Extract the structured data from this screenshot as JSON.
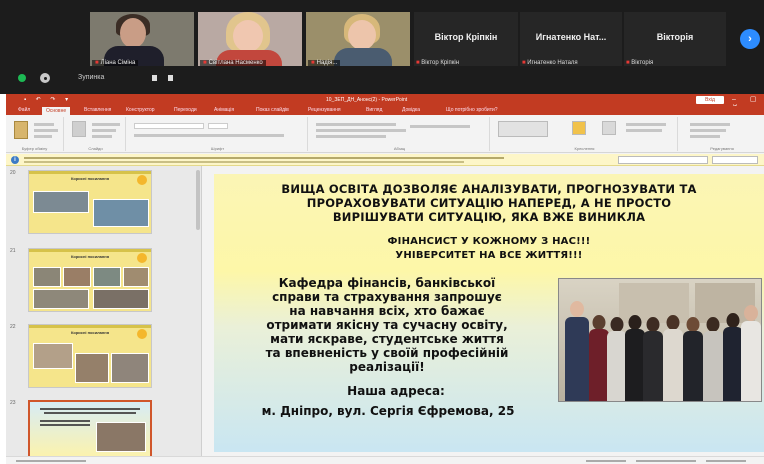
{
  "conference": {
    "participants": [
      {
        "name": "Ліана Сіміна",
        "kind": "video"
      },
      {
        "name": "Світлана Насменко",
        "kind": "video"
      },
      {
        "name": "Надія...",
        "kind": "video"
      },
      {
        "name": "Віктор Кріпкін",
        "kind": "name",
        "subname": "Віктор Кріпкін"
      },
      {
        "name": "Игнатенко Нат...",
        "kind": "name",
        "subname": "Игнатенко Наталя"
      },
      {
        "name": "Вікторія",
        "kind": "name",
        "subname": "Вікторія"
      }
    ],
    "next_icon": "chevron-right-icon",
    "control_label": "Зупинка"
  },
  "powerpoint": {
    "accent": "#c23b22",
    "window_title": "10_ЗЕП_ДН_Анонс(2) - PowerPoint",
    "signin": "Вхід",
    "tabs": [
      "Файл",
      "Основне",
      "Вставлення",
      "Конструктор",
      "Переходи",
      "Анімація",
      "Показ слайдів",
      "Рецензування",
      "Вигляд",
      "Довідка",
      "Що потрібно зробити?"
    ],
    "ribbon_groups": [
      "Буфер обміну",
      "Слайди",
      "Шрифт",
      "Абзац",
      "Креслення",
      "Редагування"
    ],
    "thumbnails": [
      {
        "number": "20",
        "title": "Корисні посилання"
      },
      {
        "number": "21",
        "title": "Корисні посилання"
      },
      {
        "number": "22",
        "title": "Корисні посилання"
      },
      {
        "number": "23",
        "title": ""
      }
    ]
  },
  "slide": {
    "heading_lines": [
      "ВИЩА ОСВІТА ДОЗВОЛЯЄ АНАЛІЗУВАТИ, ПРОГНОЗУВАТИ ТА",
      "ПРОРАХОВУВАТИ СИТУАЦІЮ НАПЕРЕД, А НЕ ПРОСТО",
      "ВИРІШУВАТИ СИТУАЦІЮ, ЯКА ВЖЕ ВИНИКЛА"
    ],
    "motto_lines": [
      "ФІНАНСИСТ У КОЖНОМУ З НАС!!!",
      "УНІВЕРСИТЕТ НА ВСЕ ЖИТТЯ!!!"
    ],
    "paragraph_lines": [
      "Кафедра фінансів, банківської",
      "справи та страхування запрошує",
      "на навчання всіх, хто бажає",
      "отримати якісну та сучасну освіту,",
      "мати яскраве, студентське життя",
      "та впевненість у своїй професійній",
      "реалізації!"
    ],
    "address_heading": "Наша адреса:",
    "address": "м. Дніпро, вул. Сергія Єфремова, 25",
    "gradient_top": "#fdf7a8",
    "gradient_bottom": "#c9e6f2"
  }
}
